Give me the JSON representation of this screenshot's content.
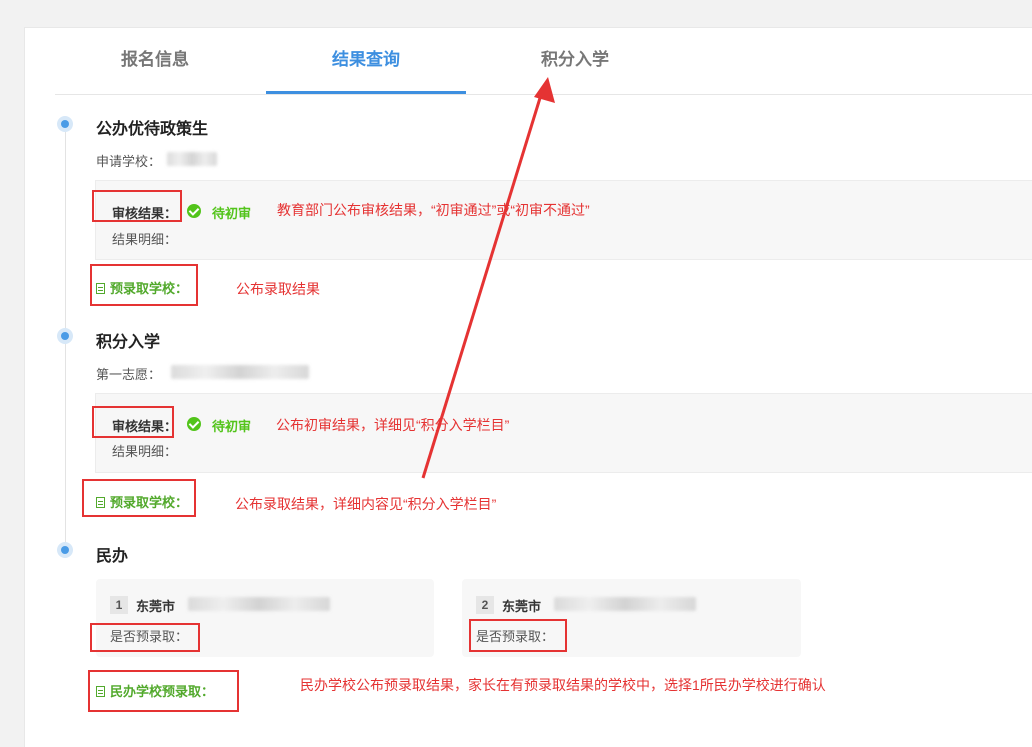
{
  "tabs": [
    {
      "label": "报名信息"
    },
    {
      "label": "结果查询"
    },
    {
      "label": "积分入学"
    }
  ],
  "section1": {
    "title": "公办优待政策生",
    "apply_label": "申请学校：",
    "result_label": "审核结果：",
    "status": "待初审",
    "detail_label": "结果明细：",
    "admit_label": "预录取学校：",
    "note_result": "教育部门公布审核结果，“初审通过”或“初审不通过”",
    "note_admit": "公布录取结果"
  },
  "section2": {
    "title": "积分入学",
    "wish_label": "第一志愿：",
    "result_label": "审核结果",
    "result_colon": "：",
    "status": "待初审",
    "detail_label": "结果明细：",
    "admit_label": "预录取学校：",
    "note_result": "公布初审结果，详细见“积分入学栏目”",
    "note_admit": "公布录取结果，详细内容见“积分入学栏目”"
  },
  "section3": {
    "title": "民办",
    "schools": [
      {
        "num": "1",
        "name": "东莞市",
        "admit_label": "是否预录取："
      },
      {
        "num": "2",
        "name": "东莞市",
        "admit_label": "是否预录取："
      }
    ],
    "admit_label": "民办学校预录取：",
    "note": "民办学校公布预录取结果，家长在有预录取结果的学校中，选择1所民办学校进行确认"
  },
  "colors": {
    "accent": "#3d8fe0",
    "success": "#52c41a",
    "annotation": "#e53333"
  }
}
